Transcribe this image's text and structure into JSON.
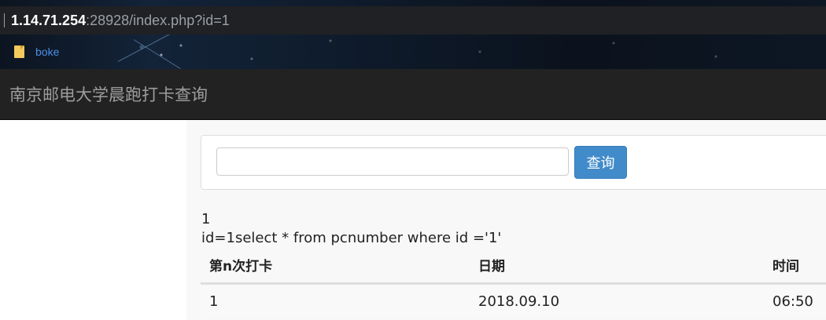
{
  "browser": {
    "url_host": "1.14.71.254",
    "url_rest": ":28928/index.php?id=1",
    "bookmark_label": "boke",
    "bookmark_icon": "bookmark-folder-icon"
  },
  "navbar": {
    "brand": "南京邮电大学晨跑打卡查询"
  },
  "search": {
    "value": "",
    "placeholder": "",
    "button_label": "查询",
    "button_color": "#428bca"
  },
  "output": {
    "line1": "1",
    "line2": "id=1select * from pcnumber where id ='1'"
  },
  "table": {
    "headers": [
      "第n次打卡",
      "日期",
      "时间"
    ],
    "rows": [
      [
        "1",
        "2018.09.10",
        "06:50"
      ]
    ]
  }
}
